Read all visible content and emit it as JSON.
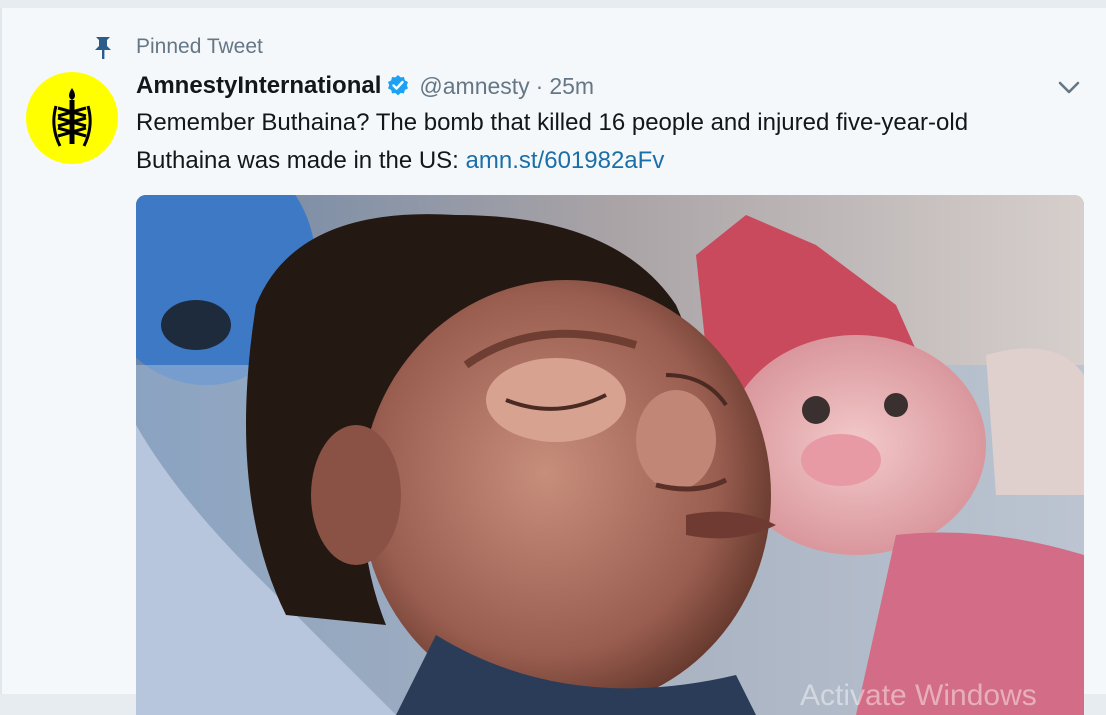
{
  "pinned": {
    "label": "Pinned Tweet",
    "icon": "pin-icon"
  },
  "tweet": {
    "author": {
      "display_name": "AmnestyInternational",
      "handle": "@amnesty",
      "verified": true,
      "avatar_icon": "candle-barbed-wire-icon",
      "avatar_color": "#ffff00"
    },
    "separator": "·",
    "time": "25m",
    "text": "Remember Buthaina? The bomb that killed 16 people and injured five-year-old Buthaina was made in the US: ",
    "link": "amn.st/601982aFv",
    "menu_icon": "chevron-down-icon"
  },
  "media": {
    "overlay_text": "Activate Windows"
  },
  "colors": {
    "link": "#1b6fa8",
    "secondary_text": "#657786",
    "verified": "#1da1f2",
    "pin": "#2e5c8a"
  }
}
